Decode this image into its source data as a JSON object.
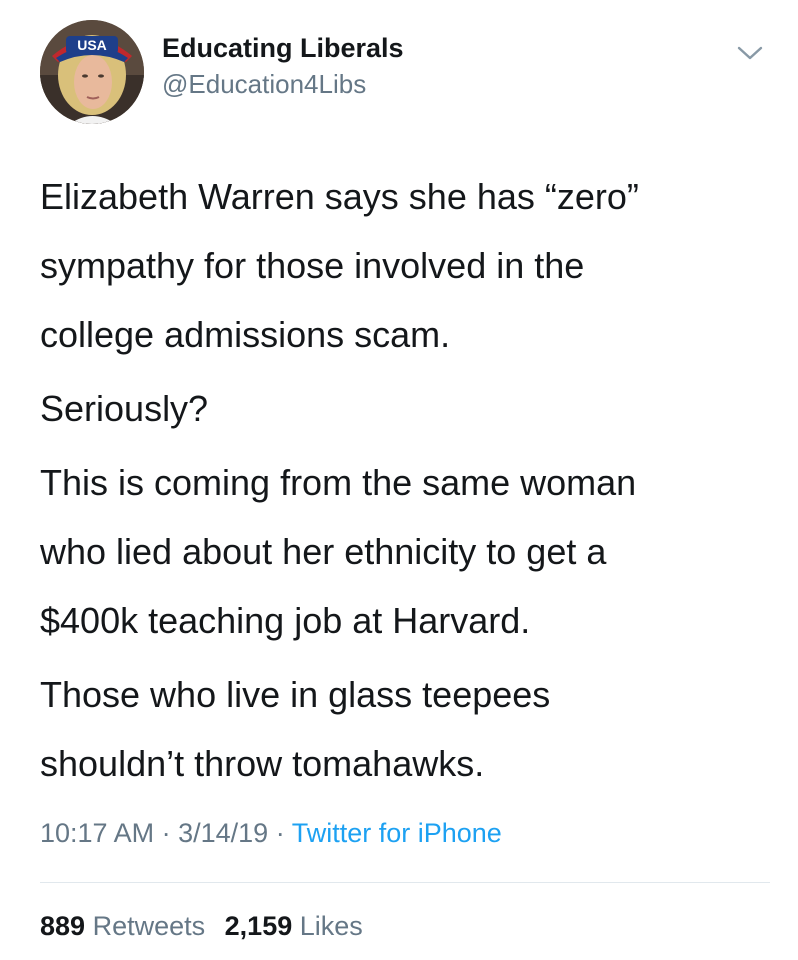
{
  "user": {
    "display_name": "Educating Liberals",
    "handle": "@Education4Libs",
    "avatar_cap_text": "USA"
  },
  "tweet": {
    "paragraphs": [
      [
        "Elizabeth Warren says she has “zero”",
        "sympathy for those involved in the",
        "college admissions scam."
      ],
      [
        "Seriously?"
      ],
      [
        "This is coming from the same woman",
        "who lied about her ethnicity to get a",
        "$400k teaching job at Harvard."
      ],
      [
        "Those who live in glass teepees",
        "shouldn’t throw tomahawks."
      ]
    ],
    "time": "10:17 AM",
    "separator": "·",
    "date": "3/14/19",
    "source": "Twitter for iPhone"
  },
  "stats": {
    "retweets_count": "889",
    "retweets_label": "Retweets",
    "likes_count": "2,159",
    "likes_label": "Likes"
  },
  "icons": {
    "menu": "chevron-down-icon"
  },
  "colors": {
    "text": "#14171a",
    "secondary": "#657786",
    "link": "#1da1f2",
    "divider": "#e1e8ed"
  }
}
